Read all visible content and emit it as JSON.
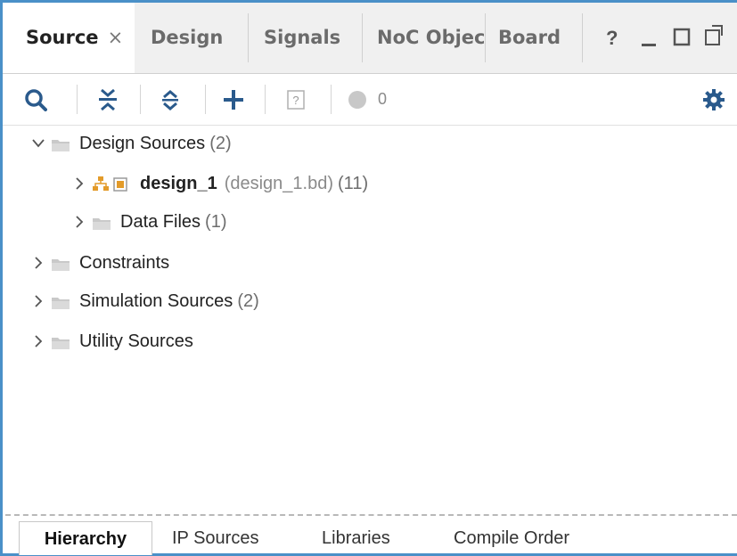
{
  "tabs": {
    "items": [
      {
        "label": "Source",
        "close": "×"
      },
      {
        "label": "Design"
      },
      {
        "label": "Signals"
      },
      {
        "label": "NoC Object"
      },
      {
        "label": "Board"
      }
    ],
    "window_buttons": {
      "help": "?",
      "minimize": "_",
      "maximize": "☐",
      "float": "⧉"
    }
  },
  "toolbar": {
    "error_count": "0",
    "icons": [
      "search-icon",
      "collapse-all-icon",
      "expand-icon",
      "add-icon",
      "unknown-file-icon",
      "status-dot-icon",
      "gear-icon"
    ]
  },
  "tree": {
    "design_sources": {
      "label": "Design Sources",
      "count": "(2)"
    },
    "design_1": {
      "label": "design_1",
      "file": "(design_1.bd)",
      "count": "(11)"
    },
    "data_files": {
      "label": "Data Files",
      "count": "(1)"
    },
    "constraints": {
      "label": "Constraints"
    },
    "simulation_sources": {
      "label": "Simulation Sources",
      "count": "(2)"
    },
    "utility_sources": {
      "label": "Utility Sources"
    }
  },
  "bottom_tabs": [
    {
      "label": "Hierarchy"
    },
    {
      "label": "IP Sources"
    },
    {
      "label": "Libraries"
    },
    {
      "label": "Compile Order"
    }
  ],
  "colors": {
    "accent": "#4a90c8",
    "folder": "#c9c9c9",
    "bd_icon": "#e39b2a",
    "toolbar_icon": "#2a5a8c"
  }
}
